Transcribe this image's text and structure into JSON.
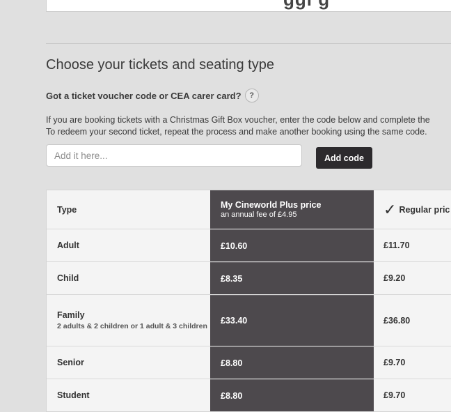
{
  "top_card": {
    "partial_text": "ggi g"
  },
  "section": {
    "title": "Choose your tickets and seating type"
  },
  "voucher": {
    "question": "Got a ticket voucher code or CEA carer card?",
    "help_label": "?",
    "instruction_line1": "If you are booking tickets with a Christmas Gift Box voucher, enter the code below and complete the",
    "instruction_line2": "To redeem your second ticket, repeat the process and make another booking using the same code.",
    "input_placeholder": "Add it here...",
    "input_value": "",
    "add_code_label": "Add code"
  },
  "price_table": {
    "header": {
      "type": "Type",
      "plus_title": "My Cineworld Plus price",
      "plus_subtitle": "an annual fee of £4.95",
      "regular_title": "Regular pric",
      "check_glyph": "✓"
    },
    "rows": [
      {
        "type": "Adult",
        "sub": "",
        "plus": "£10.60",
        "regular": "£11.70"
      },
      {
        "type": "Child",
        "sub": "",
        "plus": "£8.35",
        "regular": "£9.20"
      },
      {
        "type": "Family",
        "sub": "2 adults & 2 children or 1 adult & 3 children",
        "plus": "£33.40",
        "regular": "£36.80"
      },
      {
        "type": "Senior",
        "sub": "",
        "plus": "£8.80",
        "regular": "£9.70"
      },
      {
        "type": "Student",
        "sub": "",
        "plus": "£8.80",
        "regular": "£9.70"
      }
    ]
  },
  "colors": {
    "plus_column": "#4d494d",
    "button": "#2c2a2d",
    "background": "#e0e0e0"
  }
}
